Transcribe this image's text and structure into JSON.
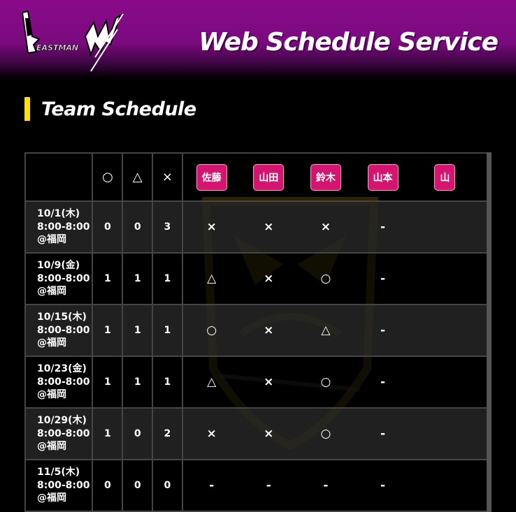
{
  "header": {
    "site_title": "Web Schedule Service",
    "logo_label": "BEASTMANX"
  },
  "section": {
    "title": "Team Schedule"
  },
  "table": {
    "count_headers": [
      "○",
      "△",
      "×"
    ],
    "members": [
      "佐藤",
      "山田",
      "鈴木",
      "山本",
      "山"
    ],
    "rows": [
      {
        "date": "10/1(木)",
        "time": "8:00-8:00",
        "place": "@福岡",
        "counts": [
          "0",
          "0",
          "3"
        ],
        "marks": [
          "×",
          "×",
          "×",
          "-",
          ""
        ]
      },
      {
        "date": "10/9(金)",
        "time": "8:00-8:00",
        "place": "@福岡",
        "counts": [
          "1",
          "1",
          "1"
        ],
        "marks": [
          "△",
          "×",
          "○",
          "-",
          ""
        ]
      },
      {
        "date": "10/15(木)",
        "time": "8:00-8:00",
        "place": "@福岡",
        "counts": [
          "1",
          "1",
          "1"
        ],
        "marks": [
          "○",
          "×",
          "△",
          "-",
          ""
        ]
      },
      {
        "date": "10/23(金)",
        "time": "8:00-8:00",
        "place": "@福岡",
        "counts": [
          "1",
          "1",
          "1"
        ],
        "marks": [
          "△",
          "×",
          "○",
          "-",
          ""
        ]
      },
      {
        "date": "10/29(木)",
        "time": "8:00-8:00",
        "place": "@福岡",
        "counts": [
          "1",
          "0",
          "2"
        ],
        "marks": [
          "×",
          "×",
          "○",
          "-",
          ""
        ]
      },
      {
        "date": "11/5(木)",
        "time": "8:00-8:00",
        "place": "@福岡",
        "counts": [
          "0",
          "0",
          "0"
        ],
        "marks": [
          "-",
          "-",
          "-",
          "-",
          ""
        ]
      }
    ]
  },
  "colors": {
    "header_purple": "#8a0a8a",
    "accent_yellow": "#ffe100",
    "member_badge": "#d4146f",
    "row_dark": "#262626"
  }
}
